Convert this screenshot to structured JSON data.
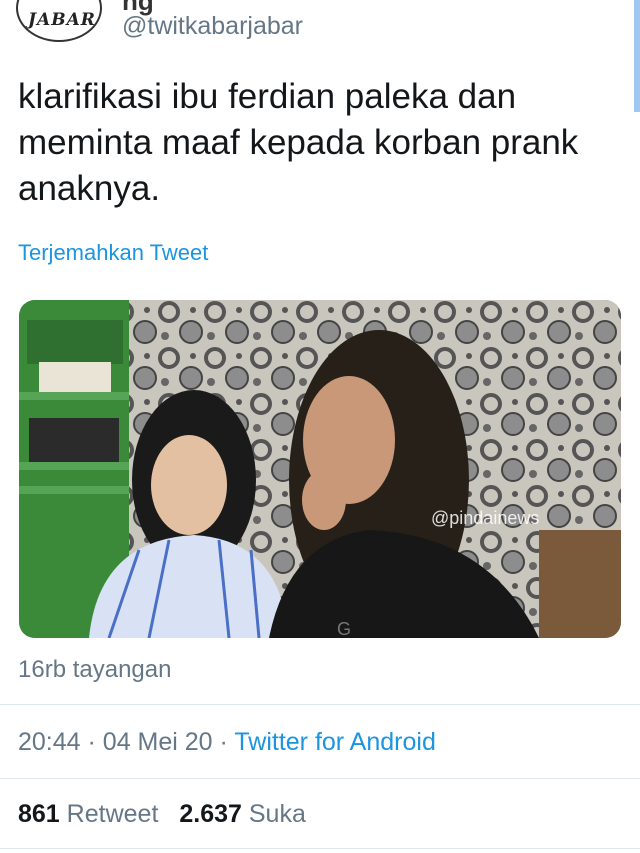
{
  "profile": {
    "avatar_text": "JABAR",
    "display_name_fragment": "ng",
    "handle": "@twitkabarjabar"
  },
  "tweet": {
    "text": "klarifikasi ibu ferdian paleka dan meminta maaf kepada korban prank anaknya.",
    "translate_label": "Terjemahkan Tweet"
  },
  "media": {
    "watermark": "@pindainews",
    "shirt_text": "G"
  },
  "views": "16rb tayangan",
  "meta": {
    "time": "20:44",
    "separator": "·",
    "date": "04 Mei 20",
    "source": "Twitter for Android"
  },
  "stats": {
    "retweet_count": "861",
    "retweet_label": "Retweet",
    "like_count": "2.637",
    "like_label": "Suka"
  },
  "colors": {
    "link": "#1b95e0",
    "secondary_text": "#657786",
    "primary_text": "#14171a",
    "divider": "#e1e8ed"
  }
}
